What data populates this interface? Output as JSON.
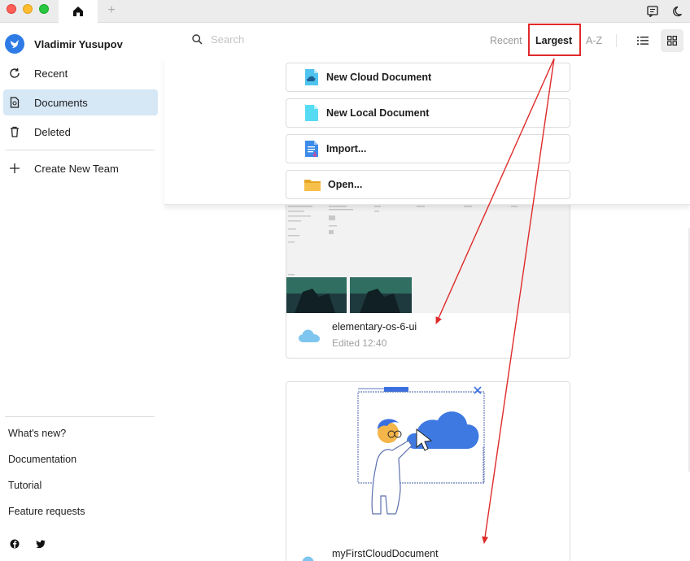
{
  "sidebar": {
    "user_name": "Vladimir Yusupov",
    "nav": [
      {
        "label": "Recent",
        "icon": "refresh-icon"
      },
      {
        "label": "Documents",
        "icon": "document-icon"
      },
      {
        "label": "Deleted",
        "icon": "trash-icon"
      },
      {
        "label": "Create New Team",
        "icon": "plus-icon"
      }
    ],
    "footer": [
      "What's new?",
      "Documentation",
      "Tutorial",
      "Feature requests"
    ]
  },
  "toolbar": {
    "search_placeholder": "Search",
    "sort_recent": "Recent",
    "sort_largest": "Largest",
    "sort_az": "A-Z",
    "active_sort": "Largest"
  },
  "new_menu": [
    {
      "label": "New Cloud Document",
      "icon": "cloud-document-icon"
    },
    {
      "label": "New Local Document",
      "icon": "local-document-icon"
    },
    {
      "label": "Import...",
      "icon": "import-icon"
    },
    {
      "label": "Open...",
      "icon": "folder-icon"
    }
  ],
  "documents": [
    {
      "title": "elementary-os-6-ui",
      "edited": "Edited 12:40",
      "icon": "cloud-icon"
    },
    {
      "title": "myFirstCloudDocument",
      "edited": "",
      "icon": "cloud-icon"
    }
  ],
  "colors": {
    "accent": "#2f7be6",
    "active_nav": "#d6e7f5",
    "annotation_red": "#e02a2a"
  }
}
